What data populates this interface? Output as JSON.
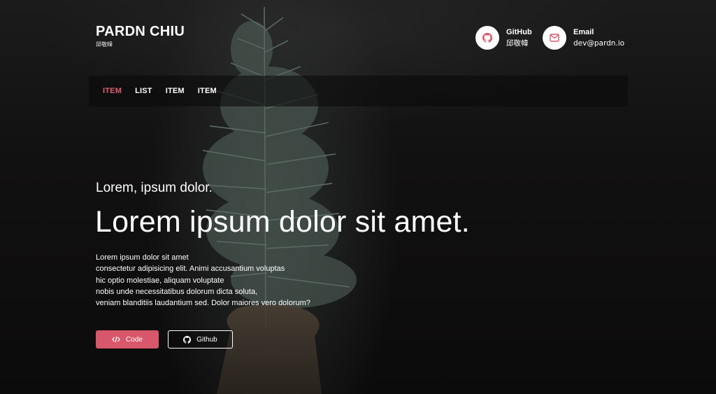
{
  "brand": {
    "title": "PARDN CHIU",
    "subtitle": "邱敬幃"
  },
  "contacts": {
    "github": {
      "label": "GitHub",
      "value": "邱敬幃"
    },
    "email": {
      "label": "Email",
      "value": "dev@pardn.io"
    }
  },
  "nav": {
    "items": [
      {
        "label": "ITEM",
        "active": true
      },
      {
        "label": "LIST",
        "active": false
      },
      {
        "label": "ITEM",
        "active": false
      },
      {
        "label": "ITEM",
        "active": false
      }
    ]
  },
  "hero": {
    "kicker": "Lorem, ipsum dolor.",
    "title": "Lorem ipsum dolor sit amet.",
    "lines": [
      "Lorem ipsum dolor sit amet",
      "consectetur adipisicing elit. Animi accusantium voluptas",
      "hic optio molestiae, aliquam voluptate",
      "nobis unde necessitatibus dolorum dicta soluta,",
      "veniam blanditiis laudantium sed. Dolor maiores vero dolorum?"
    ]
  },
  "buttons": {
    "code": "Code",
    "github": "Github"
  },
  "icons": {
    "github": "github-icon",
    "email": "envelope-icon",
    "code": "code-icon"
  },
  "colors": {
    "accent": "#d9576a",
    "nav_active": "#e06070",
    "background": "#0f0e0e"
  }
}
